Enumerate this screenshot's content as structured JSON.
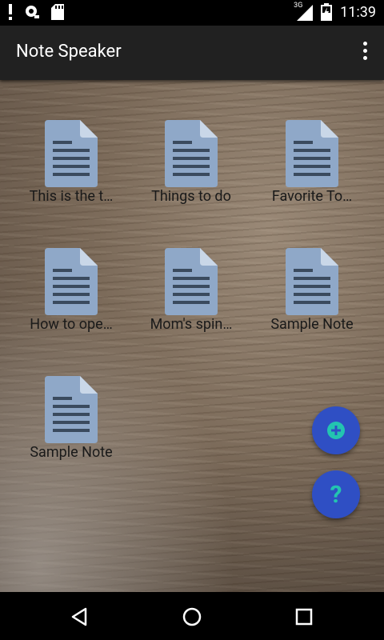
{
  "status_bar": {
    "time": "11:39",
    "network_type": "3G",
    "left_icons": [
      "notification-alert-icon",
      "vpn-key-icon",
      "sd-card-icon"
    ],
    "right_icons": [
      "signal-icon",
      "battery-charging-icon"
    ]
  },
  "app_bar": {
    "title": "Note Speaker",
    "menu_icon": "overflow-menu-icon"
  },
  "notes": [
    {
      "label": "This is the t…",
      "icon": "document-icon"
    },
    {
      "label": "Things to do",
      "icon": "document-icon"
    },
    {
      "label": "Favorite To…",
      "icon": "document-icon"
    },
    {
      "label": "How to ope…",
      "icon": "document-icon"
    },
    {
      "label": "Mom's spin…",
      "icon": "document-icon"
    },
    {
      "label": "Sample Note",
      "icon": "document-icon"
    },
    {
      "label": "Sample Note",
      "icon": "document-icon"
    }
  ],
  "fabs": {
    "add_icon": "add-icon",
    "help_label": "?"
  },
  "nav_bar": {
    "icons": [
      "back-icon",
      "home-icon",
      "recents-icon"
    ]
  },
  "colors": {
    "app_bar": "#212121",
    "fab": "#2f4fc4",
    "fab_accent": "#23c4b0",
    "doc_icon": "#8fa8c8",
    "doc_lines": "#3a4a5e"
  }
}
